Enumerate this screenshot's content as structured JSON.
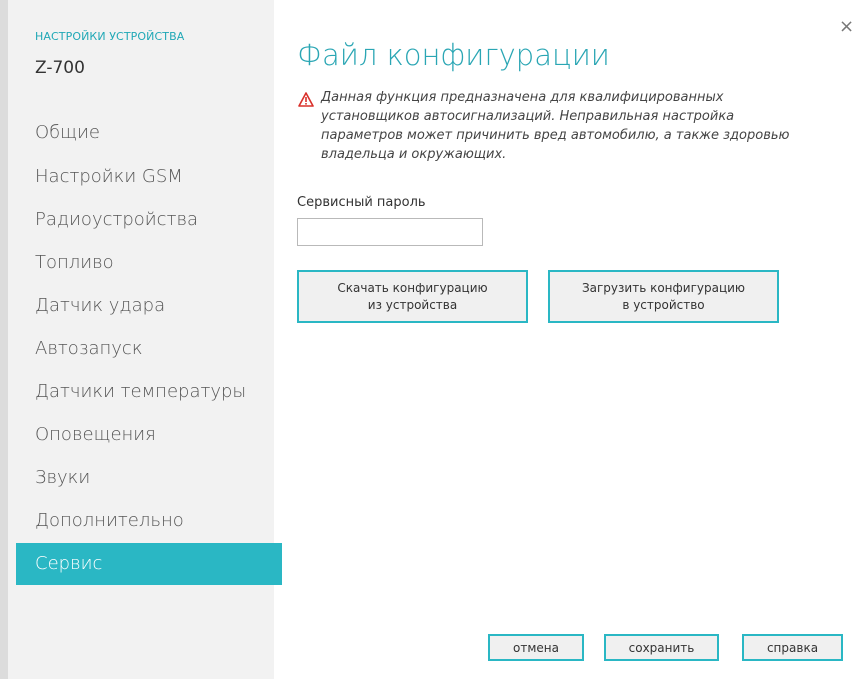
{
  "sidebar": {
    "caption": "НАСТРОЙКИ УСТРОЙСТВА",
    "device": "Z-700",
    "items": [
      {
        "label": "Общие"
      },
      {
        "label": "Настройки GSM"
      },
      {
        "label": "Радиоустройства"
      },
      {
        "label": "Топливо"
      },
      {
        "label": "Датчик удара"
      },
      {
        "label": "Автозапуск"
      },
      {
        "label": "Датчики температуры"
      },
      {
        "label": "Оповещения"
      },
      {
        "label": "Звуки"
      },
      {
        "label": "Дополнительно"
      },
      {
        "label": "Сервис",
        "active": true
      }
    ]
  },
  "main": {
    "close_symbol": "×",
    "title": "Файл конфигурации",
    "warning": "Данная функция предназначена для квалифицированных установщиков автосигнализаций. Неправильная настройка параметров может причинить вред автомобилю, а также здоровью владельца и окружающих.",
    "password_label": "Сервисный пароль",
    "password_value": "",
    "download_button": "Скачать конфигурацию\nиз устройства",
    "upload_button": "Загрузить конфигурацию\nв устройство"
  },
  "footer": {
    "cancel": "отмена",
    "save": "сохранить",
    "help": "справка"
  },
  "colors": {
    "accent": "#2ab7c4",
    "title": "#2aa6b4",
    "warning_icon": "#d9302a"
  },
  "icons": {
    "warning": "warning-triangle-icon",
    "close": "close-icon"
  }
}
